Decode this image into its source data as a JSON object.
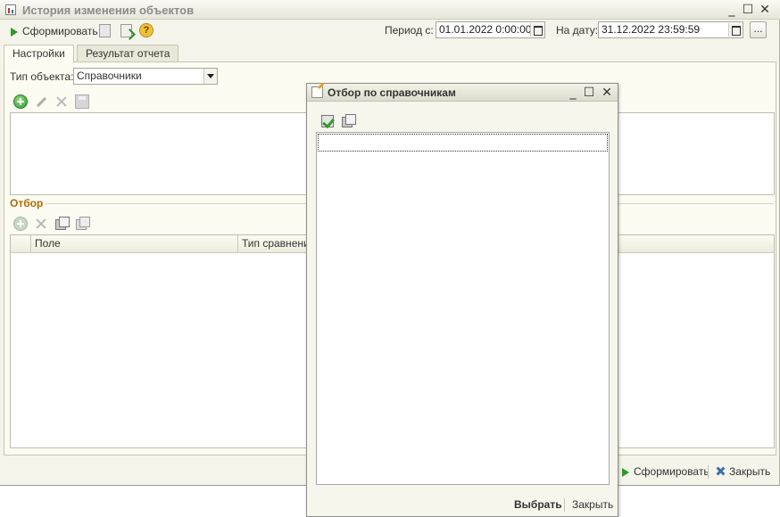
{
  "window": {
    "title": "История изменения объектов",
    "controls": {
      "minimize": "_",
      "maximize": "☐",
      "close": "✕"
    }
  },
  "toolbar": {
    "generate_label": "Сформировать",
    "help_label": "?"
  },
  "period": {
    "from_label": "Период с:",
    "from_value": "01.01.2022  0:00:00",
    "to_label": "На дату:",
    "to_value": "31.12.2022 23:59:59",
    "more_label": "..."
  },
  "tabs": [
    {
      "label": "Настройки",
      "active": true
    },
    {
      "label": "Результат отчета",
      "active": false
    }
  ],
  "settings": {
    "object_type_label": "Тип объекта:",
    "object_type_value": "Справочники"
  },
  "filter": {
    "section_title": "Отбор",
    "columns": [
      "Поле",
      "Тип сравнения"
    ]
  },
  "bottom": {
    "generate_label": "Сформировать",
    "close_label": "Закрыть"
  },
  "modal": {
    "title": "Отбор по справочникам",
    "controls": {
      "minimize": "_",
      "maximize": "☐",
      "close": "✕"
    },
    "select_label": "Выбрать",
    "close_label": "Закрыть"
  },
  "colors": {
    "section_title": "#b36a00",
    "accent_green": "#2a9a2a",
    "close_blue": "#3b6fb0"
  }
}
